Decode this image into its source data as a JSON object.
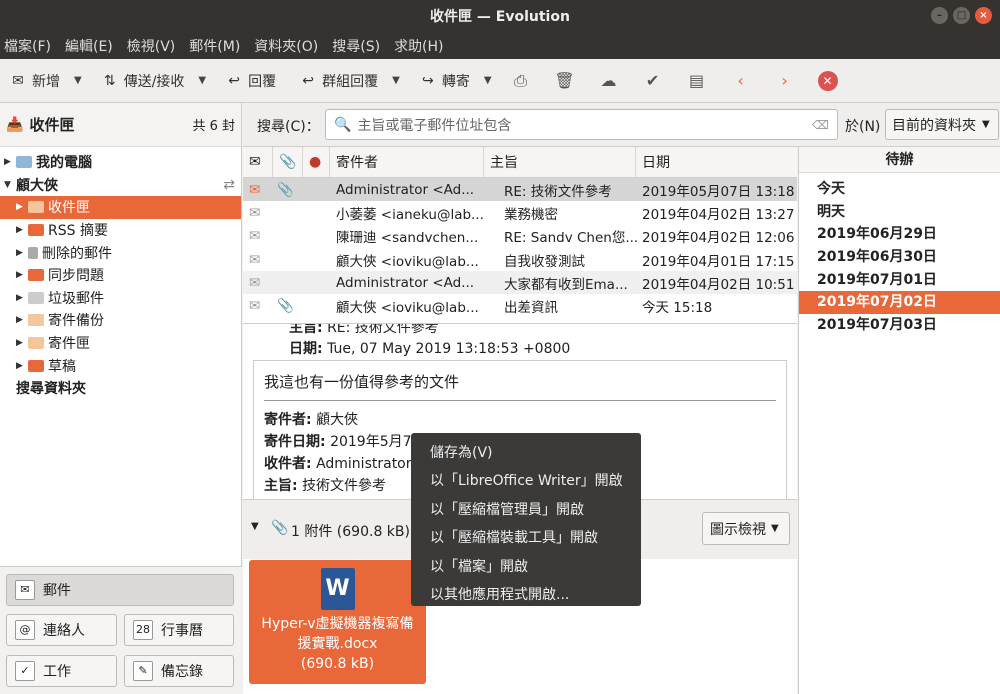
{
  "window": {
    "title": "收件匣 — Evolution"
  },
  "menu": [
    "檔案(F)",
    "編輯(E)",
    "檢視(V)",
    "郵件(M)",
    "資料夾(O)",
    "搜尋(S)",
    "求助(H)"
  ],
  "toolbar": {
    "new": "新增",
    "send_receive": "傳送/接收",
    "reply": "回覆",
    "reply_group": "群組回覆",
    "forward": "轉寄"
  },
  "folders": {
    "header": "收件匣",
    "count": "共 6 封",
    "items": [
      "我的電腦",
      "顧大俠",
      "收件匣",
      "RSS 摘要",
      "刪除的郵件",
      "同步問題",
      "垃圾郵件",
      "寄件備份",
      "寄件匣",
      "草稿",
      "搜尋資料夾"
    ]
  },
  "search": {
    "label": "搜尋(C)：",
    "placeholder": "主旨或電子郵件位址包含",
    "in_label": "於(N)",
    "scope": "目前的資料夾"
  },
  "columns": {
    "from": "寄件者",
    "subject": "主旨",
    "date": "日期"
  },
  "messages": [
    {
      "from": "Administrator <Ad...",
      "subject": "RE: 技術文件參考",
      "date": "2019年05月07日 13:18"
    },
    {
      "from": "小萎萎 <ianeku@lab...",
      "subject": "業務機密",
      "date": "2019年04月02日 13:27"
    },
    {
      "from": "陳珊迪 <sandvchen...",
      "subject": "RE: Sandv Chen您...",
      "date": "2019年04月02日 12:06"
    },
    {
      "from": "顧大俠 <ioviku@lab...",
      "subject": "自我收發測試",
      "date": "2019年04月01日 17:15"
    },
    {
      "from": "Administrator <Ad...",
      "subject": "大家都有收到Ema...",
      "date": "2019年04月02日 10:51"
    },
    {
      "from": "顧大俠 <ioviku@lab...",
      "subject": "出差資訊",
      "date": "今天 15:18"
    }
  ],
  "todo": {
    "header": "待辦",
    "dates": [
      "今天",
      "明天",
      "2019年06月29日",
      "2019年06月30日",
      "2019年07月01日",
      "2019年07月02日",
      "2019年07月03日"
    ]
  },
  "preview": {
    "subject_label": "主旨:",
    "subject": "RE: 技術文件參考",
    "date_label": "日期:",
    "date": "Tue, 07 May 2019 13:18:53 +0800",
    "body_title": "我這也有一份值得參考的文件",
    "from_label": "寄件者:",
    "from": "顧大俠",
    "sent_label": "寄件日期:",
    "sent": "2019年5月7日",
    "to_label": "收件者:",
    "to": "Administrator",
    "subj_label": "主旨:",
    "subj": "技術文件參考"
  },
  "attachments": {
    "summary": "1 附件 (690.8 kB)",
    "view": "圖示檢視",
    "file_name": "Hyper-v虛擬機器複寫備援實戰.docx",
    "file_size": "(690.8 kB)"
  },
  "context_menu": [
    "儲存為(V)",
    "以「LibreOffice Writer」開啟",
    "以「壓縮檔管理員」開啟",
    "以「壓縮檔裝載工具」開啟",
    "以「檔案」開啟",
    "以其他應用程式開啟..."
  ],
  "switcher": {
    "mail": "郵件",
    "contacts": "連絡人",
    "calendar": "行事曆",
    "tasks": "工作",
    "memos": "備忘錄"
  },
  "colors": {
    "accent": "#e9683a",
    "titlebar": "#35322f"
  }
}
